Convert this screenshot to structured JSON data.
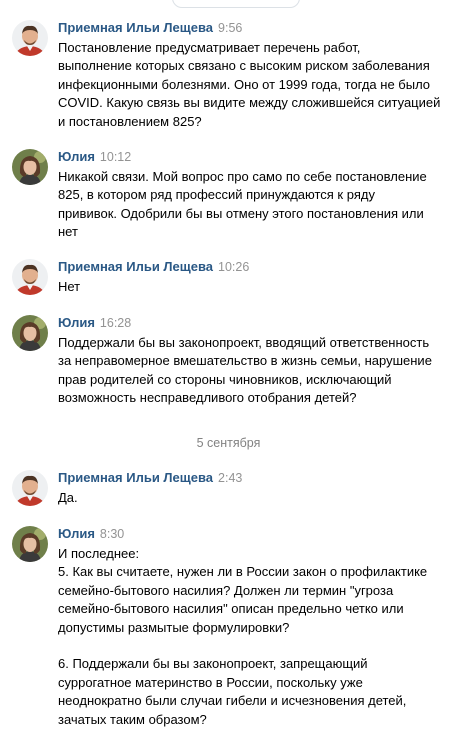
{
  "messages": [
    {
      "author": "Приемная Ильи Лещева",
      "time": "9:56",
      "text": "Постановление предусматривает перечень работ,\nвыполнение которых связано с высоким риском заболевания\nинфекционными болезнями. Оно от 1999 года, тогда не было\nCOVID. Какую связь вы видите между сложившейся ситуацией\nи постановлением 825?",
      "avatar": "man-avatar"
    },
    {
      "author": "Юлия",
      "time": "10:12",
      "text": "Никакой связи. Мой вопрос про само по себе постановление\n825, в котором ряд профессий принуждаются к ряду\nпрививок. Одобрили бы вы отмену этого постановления или\nнет",
      "avatar": "woman-avatar"
    },
    {
      "author": "Приемная Ильи Лещева",
      "time": "10:26",
      "text": "Нет",
      "avatar": "man-avatar"
    },
    {
      "author": "Юлия",
      "time": "16:28",
      "text": "Поддержали бы вы законопроект, вводящий ответственность\nза неправомерное вмешательство в жизнь семьи, нарушение\nправ родителей со стороны чиновников, исключающий\nвозможность несправедливого отобрания детей?",
      "avatar": "woman-avatar"
    },
    {
      "author": "Приемная Ильи Лещева",
      "time": "2:43",
      "text": "Да.",
      "avatar": "man-avatar"
    },
    {
      "author": "Юлия",
      "time": "8:30",
      "text": "И последнее:\n5. Как вы считаете, нужен ли в России закон о профилактике\nсемейно-бытового насилия? Должен ли термин \"угроза\nсемейно-бытового насилия\" описан предельно четко или\nдопустимы размытые формулировки?\n\n6. Поддержали бы вы законопроект, запрещающий\nсуррогатное материнство в России, поскольку уже\nнеоднократно были случаи гибели и исчезновения детей,\nзачатых таким образом?",
      "avatar": "woman-avatar"
    }
  ],
  "date_separator": "5 сентября",
  "colors": {
    "author": "#2a5885",
    "time": "#939393",
    "date": "#828282"
  }
}
